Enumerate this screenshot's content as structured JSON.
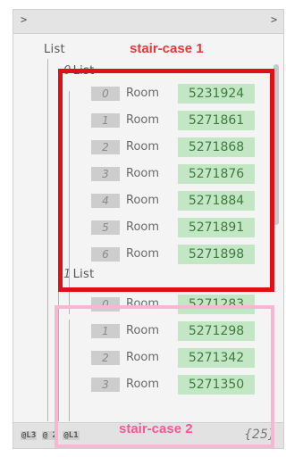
{
  "topbar": {
    "left_arrow": ">",
    "right_arrow": ">"
  },
  "root": {
    "label": "List"
  },
  "sublists": [
    {
      "index": "0",
      "label": "List"
    },
    {
      "index": "1",
      "label": "List"
    }
  ],
  "rows_a": [
    {
      "index": "0",
      "room": "Room",
      "value": "5231924"
    },
    {
      "index": "1",
      "room": "Room",
      "value": "5271861"
    },
    {
      "index": "2",
      "room": "Room",
      "value": "5271868"
    },
    {
      "index": "3",
      "room": "Room",
      "value": "5271876"
    },
    {
      "index": "4",
      "room": "Room",
      "value": "5271884"
    },
    {
      "index": "5",
      "room": "Room",
      "value": "5271891"
    },
    {
      "index": "6",
      "room": "Room",
      "value": "5271898"
    }
  ],
  "rows_b": [
    {
      "index": "0",
      "room": "Room",
      "value": "5271283"
    },
    {
      "index": "1",
      "room": "Room",
      "value": "5271298"
    },
    {
      "index": "2",
      "room": "Room",
      "value": "5271342"
    },
    {
      "index": "3",
      "room": "Room",
      "value": "5271350"
    }
  ],
  "footer": {
    "tag1": "@L3",
    "tag2": "@ 2",
    "tag3": "@L1",
    "count": "{25}"
  },
  "annotations": {
    "group1": "stair-case 1",
    "group2": "stair-case 2"
  },
  "colors": {
    "value_bg": "#c3e7c4",
    "value_text": "#3f7a41",
    "annotation_red": "#e0101a",
    "annotation_pink": "#f7b6d2"
  }
}
